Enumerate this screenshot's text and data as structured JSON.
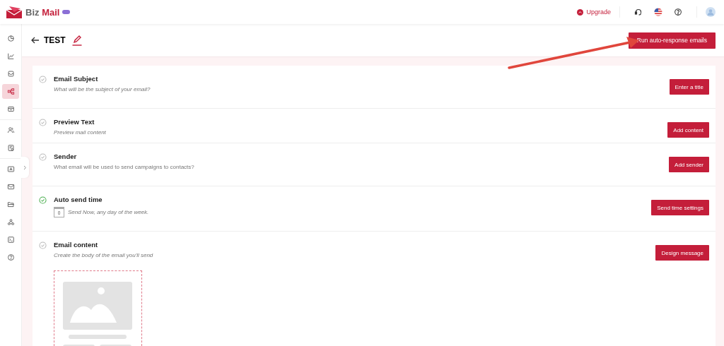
{
  "header": {
    "brand": [
      "Biz",
      "Mail"
    ],
    "upgrade": "Upgrade"
  },
  "sidebar": {
    "groups": [
      {
        "items": [
          {
            "selected": false
          },
          {
            "selected": false
          },
          {
            "selected": false
          },
          {
            "selected": true
          },
          {
            "selected": false
          }
        ]
      },
      {
        "items": [
          {
            "selected": false
          },
          {
            "selected": false
          }
        ]
      },
      {
        "items": [
          {
            "selected": false
          },
          {
            "selected": false
          },
          {
            "selected": false
          },
          {
            "selected": false
          },
          {
            "selected": false
          },
          {
            "selected": false
          }
        ]
      }
    ]
  },
  "page": {
    "title": "TEST",
    "run_button": "Run auto-response emails"
  },
  "steps": [
    {
      "kind": "text",
      "done": false,
      "title": "Email Subject",
      "subtitle": "What will be the subject of your email?",
      "italic": true,
      "button": "Enter a title"
    },
    {
      "kind": "text",
      "done": false,
      "title": "Preview Text",
      "subtitle": "Preview mail content",
      "italic": true,
      "button": "Add content"
    },
    {
      "kind": "text",
      "done": false,
      "title": "Sender",
      "subtitle": "What email will be used to send campaigns to contacts?",
      "italic": false,
      "button": "Add sender"
    },
    {
      "kind": "schedule",
      "done": true,
      "title": "Auto send time",
      "day": "0",
      "subtitle": "Send Now, any day of the week.",
      "italic": true,
      "button": "Send time settings"
    },
    {
      "kind": "preview",
      "done": false,
      "title": "Email content",
      "subtitle": "Create the body of the email you'll send",
      "italic": true,
      "button": "Design message"
    }
  ]
}
